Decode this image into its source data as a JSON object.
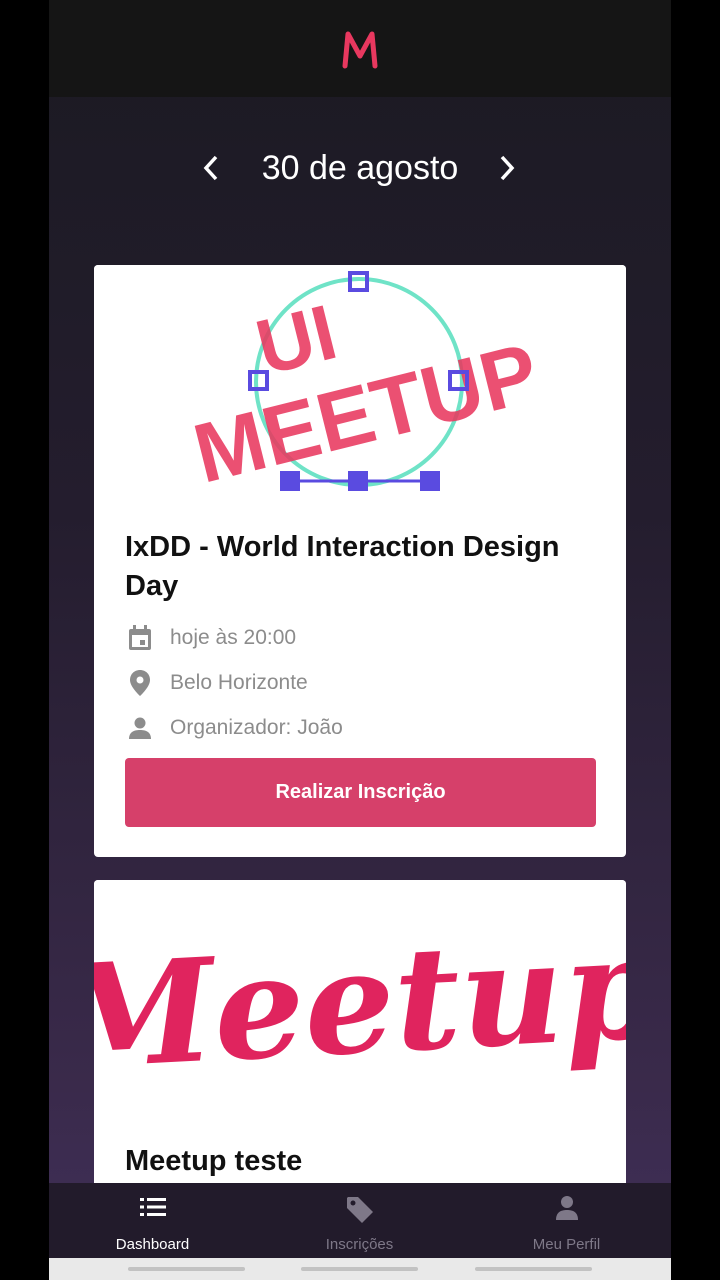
{
  "header": {
    "logo_icon": "meetup-m-logo",
    "brand_color": "#e8385f"
  },
  "date_nav": {
    "prev_icon": "chevron-left-icon",
    "date": "30 de agosto",
    "next_icon": "chevron-right-icon"
  },
  "events": [
    {
      "image_text": [
        "UI",
        "MEETUP"
      ],
      "title": "IxDD - World Interaction Design Day",
      "date_text": "hoje às 20:00",
      "location": "Belo Horizonte",
      "organizer": "Organizador: João",
      "button_label": "Realizar Inscrição"
    },
    {
      "image_text": "Meetup",
      "title": "Meetup teste"
    }
  ],
  "tabs": [
    {
      "label": "Dashboard",
      "icon": "list-icon",
      "active": true
    },
    {
      "label": "Inscrições",
      "icon": "tag-icon",
      "active": false
    },
    {
      "label": "Meu Perfil",
      "icon": "person-icon",
      "active": false
    }
  ],
  "colors": {
    "accent": "#d6406a",
    "tab_active": "#ffffff",
    "tab_inactive": "#7e7888"
  }
}
